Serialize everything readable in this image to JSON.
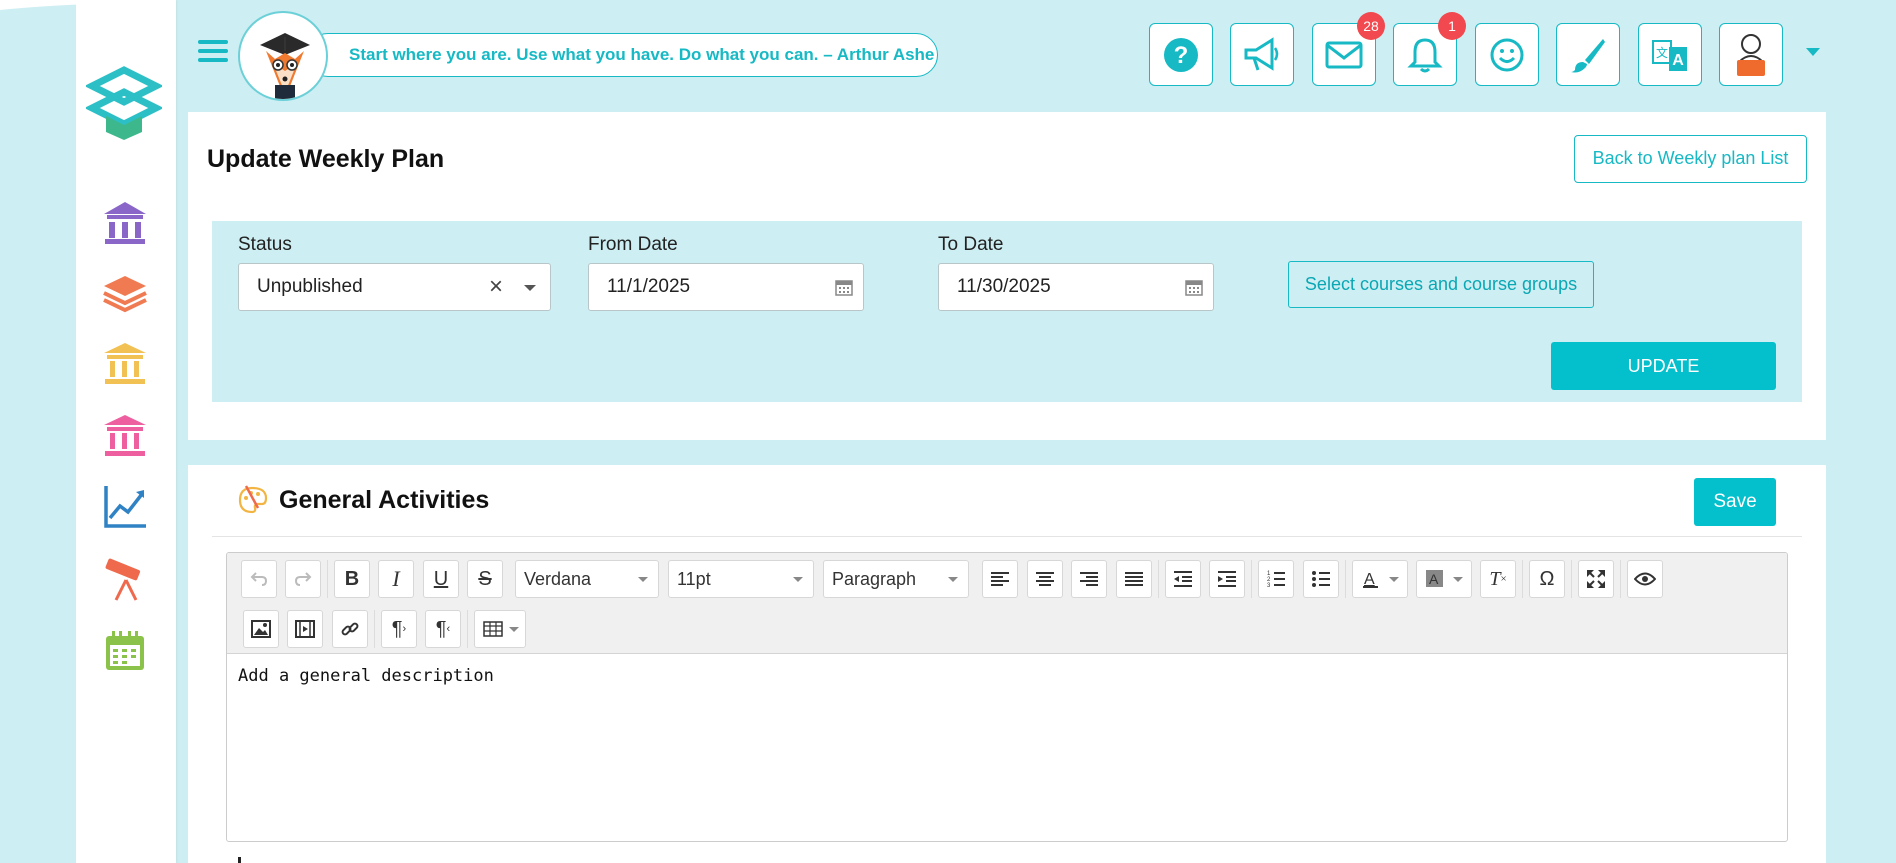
{
  "header": {
    "quote": "Start where you are. Use what you have. Do what you can. – Arthur Ashe",
    "toolbar_icons": [
      "help-icon",
      "announcement-icon",
      "mail-icon",
      "bell-icon",
      "smiley-icon",
      "brush-icon",
      "translate-icon",
      "profile-icon"
    ],
    "mail_badge": "28",
    "bell_badge": "1"
  },
  "sidebar": {
    "items": [
      "school-icon",
      "layers-icon",
      "institution-icon",
      "museum-icon",
      "chart-icon",
      "telescope-icon",
      "calendar-icon"
    ],
    "colors": [
      "#8a66c9",
      "#f07a52",
      "#f2c154",
      "#ee5fa0",
      "#2f82c4",
      "#ef6a4d",
      "#8bc34a"
    ]
  },
  "page": {
    "title": "Update Weekly Plan",
    "back_button": "Back to Weekly plan List"
  },
  "filters": {
    "status_label": "Status",
    "status_value": "Unpublished",
    "clear_glyph": "×",
    "from_label": "From Date",
    "from_value": "11/1/2025",
    "to_label": "To Date",
    "to_value": "11/30/2025",
    "select_courses": "Select courses and course groups",
    "update_button": "UPDATE"
  },
  "general": {
    "title": "General Activities",
    "save_button": "Save",
    "editor": {
      "font": "Verdana",
      "size": "11pt",
      "block": "Paragraph",
      "content": "Add a general description"
    }
  },
  "colors": {
    "accent": "#16b9c4",
    "button": "#04c0cc",
    "background": "#cdeef2",
    "badge": "#f2484f"
  }
}
